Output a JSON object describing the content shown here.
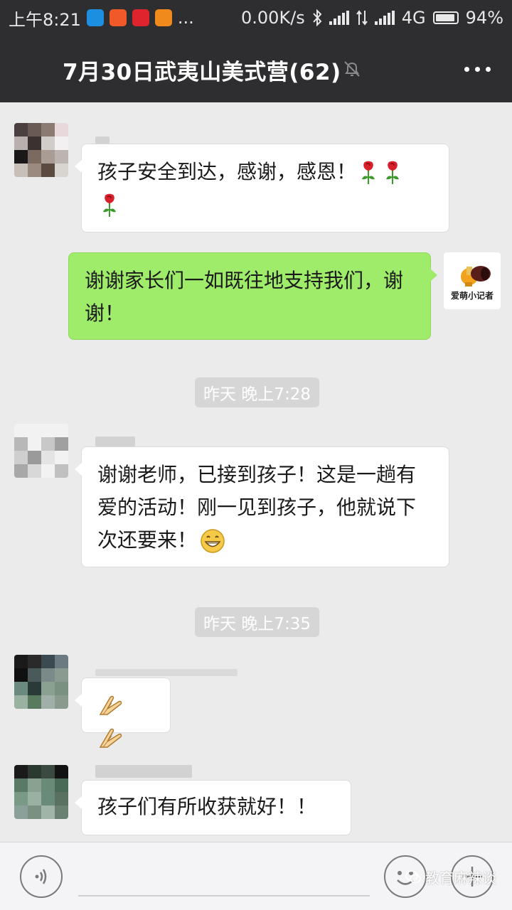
{
  "status_bar": {
    "time": "上午8:21",
    "more": "...",
    "net_speed": "0.00K/s",
    "network": "4G",
    "battery": "94%",
    "battery_level": 0.94
  },
  "header": {
    "title": "7月30日武夷山美式营(62)"
  },
  "messages": [
    {
      "side": "in",
      "text_line1": "孩子安全到达，感谢，感恩！",
      "emojis": [
        "rose",
        "rose",
        "rose"
      ]
    },
    {
      "side": "out",
      "text": "谢谢家长们一如既往地支持我们，谢谢！",
      "avatar_text": "爱萌小记者"
    },
    {
      "time": "昨天 晚上7:28"
    },
    {
      "side": "in",
      "text": "谢谢老师，已接到孩子！这是一趟有爱的活动！刚一见到孩子，他就说下次还要来！",
      "emojis": [
        "grin"
      ]
    },
    {
      "time": "昨天 晚上7:35"
    },
    {
      "side": "in",
      "emojis": [
        "clap",
        "clap"
      ]
    },
    {
      "side": "in",
      "text": "孩子们有所收获就好！！"
    }
  ],
  "watermark": "教育麻辣谈",
  "colors": {
    "header_bg": "#2e2e30",
    "chat_bg": "#ebebeb",
    "bubble_out": "#9feb6a",
    "bubble_in": "#ffffff"
  }
}
